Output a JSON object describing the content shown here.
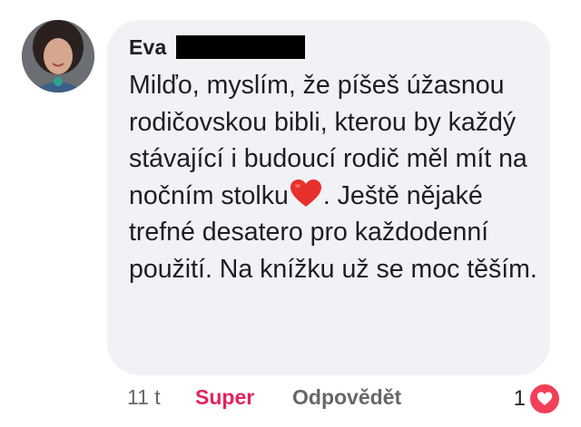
{
  "comment": {
    "author": "Eva",
    "lines_before_emoji": "Milďo, myslím, že píšeš úžasnou rodičovskou bibli, kterou by každý stávající i budoucí rodič měl mít na nočním stolku",
    "emoji": "heart-emoji",
    "lines_after_emoji": ". Ještě nějaké trefné desatero pro každodenní použití. Na knížku už se moc těším."
  },
  "actions": {
    "time": "11 t",
    "reaction_label": "Super",
    "reply_label": "Odpovědět",
    "reaction_count": "1"
  },
  "colors": {
    "bubble": "#f0f2f5",
    "super": "#e0245e",
    "heart_badge": "#f33e58"
  }
}
